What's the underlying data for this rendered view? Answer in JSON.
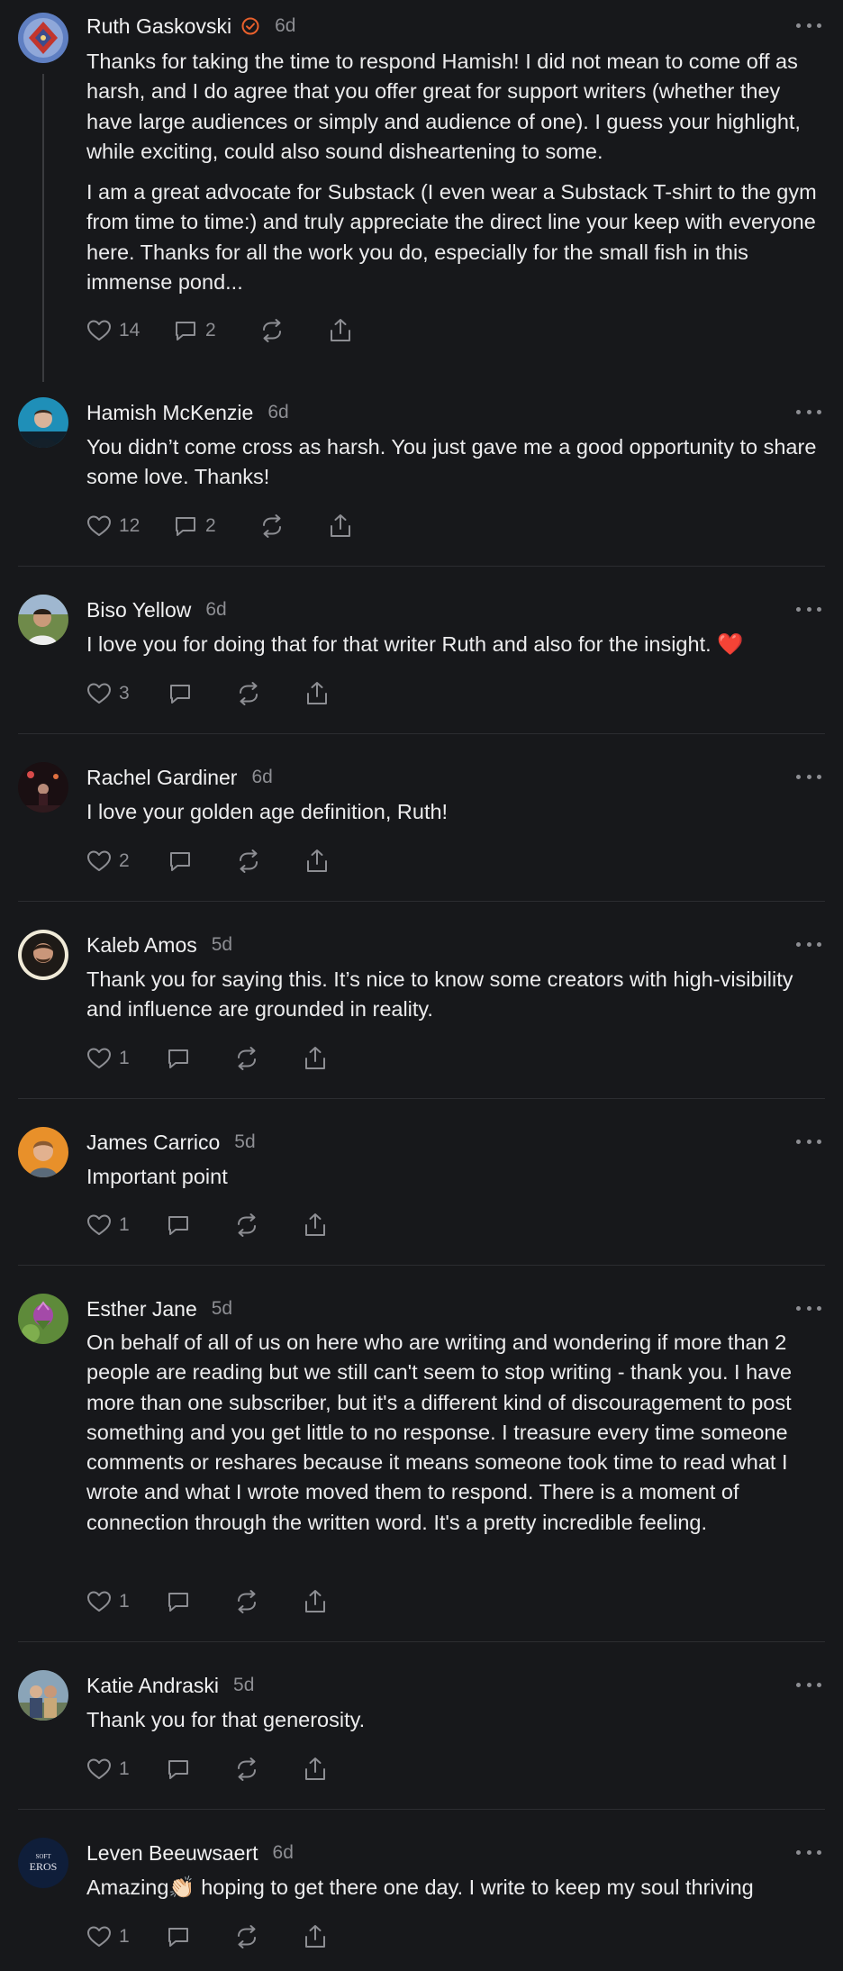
{
  "comments": [
    {
      "author": "Ruth Gaskovski",
      "verified": true,
      "time": "6d",
      "paragraphs": [
        "Thanks for taking the time to respond Hamish! I did not mean to come off as harsh, and I do agree that you offer great for support writers (whether they have large audiences or simply and audience of one). I guess your highlight, while exciting, could also sound disheartening to some.",
        "I am a great advocate for Substack (I even wear a Substack T-shirt to the gym from time to time:) and truly appreciate the direct line your keep with everyone here. Thanks for all the work you do, especially for the small fish in this immense pond..."
      ],
      "likes": "14",
      "replies": "2",
      "avatar_icon": "ornament-avatar-icon"
    },
    {
      "author": "Hamish McKenzie",
      "time": "6d",
      "paragraphs": [
        "You didn’t come cross as harsh. You just gave me a good opportunity to share some love. Thanks!"
      ],
      "likes": "12",
      "replies": "2",
      "avatar_icon": "person-avatar-icon"
    },
    {
      "author": "Biso Yellow",
      "time": "6d",
      "paragraphs": [
        "I love you for doing that for that writer Ruth and also for the insight. ❤️"
      ],
      "likes": "3",
      "replies": "",
      "avatar_icon": "person-avatar-icon"
    },
    {
      "author": "Rachel Gardiner",
      "time": "6d",
      "paragraphs": [
        "I love your golden age definition, Ruth!"
      ],
      "likes": "2",
      "replies": "",
      "avatar_icon": "stage-avatar-icon"
    },
    {
      "author": "Kaleb Amos",
      "time": "5d",
      "paragraphs": [
        "Thank you for saying this. It’s nice to know some creators with high-visibility and influence are grounded in reality."
      ],
      "likes": "1",
      "replies": "",
      "avatar_icon": "person-avatar-icon"
    },
    {
      "author": "James Carrico",
      "time": "5d",
      "paragraphs": [
        "Important point"
      ],
      "likes": "1",
      "replies": "",
      "avatar_icon": "person-avatar-icon"
    },
    {
      "author": "Esther Jane",
      "time": "5d",
      "paragraphs": [
        "On behalf of all of us on here who are writing and wondering if more than 2 people are reading but we still can't seem to stop writing - thank you. I have more than one subscriber, but it's a different kind of discouragement to post something and you get little to no response. I treasure every time someone comments or reshares because it means someone took time to read what I wrote and what I wrote moved them to respond. There is a moment of connection through the written word. It's a pretty incredible feeling."
      ],
      "likes": "1",
      "replies": "",
      "avatar_icon": "thistle-avatar-icon"
    },
    {
      "author": "Katie Andraski",
      "time": "5d",
      "paragraphs": [
        "Thank you for that generosity."
      ],
      "likes": "1",
      "replies": "",
      "avatar_icon": "people-avatar-icon"
    },
    {
      "author": "Leven Beeuwsaert",
      "time": "6d",
      "paragraphs": [
        "Amazing👏🏻 hoping to get there one day. I write to keep my soul thriving"
      ],
      "likes": "1",
      "replies": "",
      "avatar_icon": "soft-eros-logo-icon",
      "avatar_text": [
        "SOFT",
        "EROS"
      ]
    }
  ],
  "icons": {
    "like": "heart-icon",
    "reply": "comment-bubble-icon",
    "restack": "restack-icon",
    "share": "share-icon",
    "more": "more-dots-icon",
    "verified": "verified-badge-icon"
  },
  "colors": {
    "background": "#17181b",
    "verified_badge": "#e8602c"
  }
}
